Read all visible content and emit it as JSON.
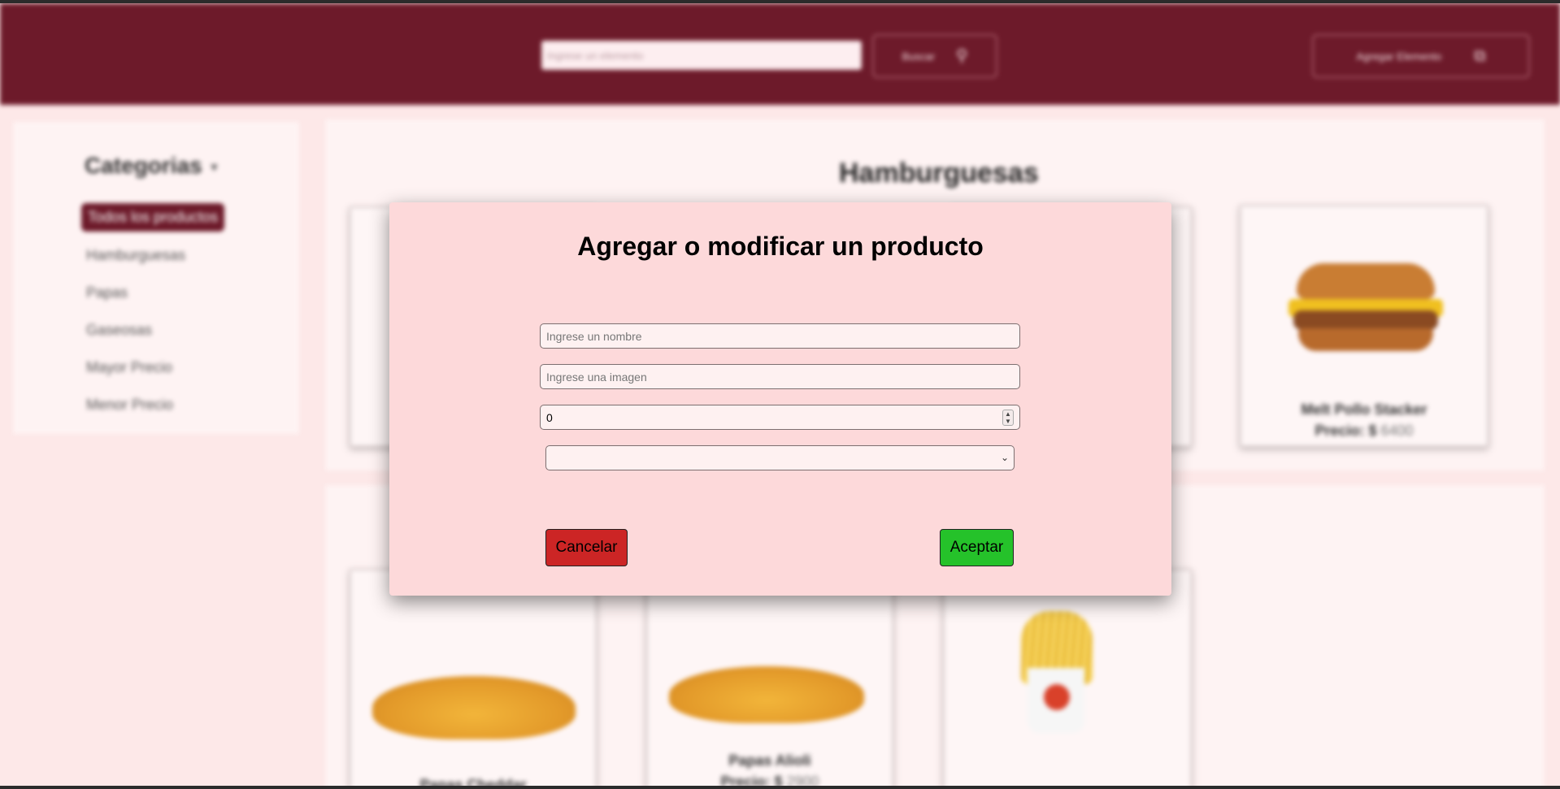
{
  "header": {
    "search_placeholder": "Ingrese un elemento",
    "search_button": "Buscar",
    "add_button": "Agregar Elemento"
  },
  "sidebar": {
    "title": "Categorias",
    "items": [
      {
        "label": "Todos los productos",
        "active": true
      },
      {
        "label": "Hamburguesas"
      },
      {
        "label": "Papas"
      },
      {
        "label": "Gaseosas"
      },
      {
        "label": "Mayor Precio"
      },
      {
        "label": "Menor Precio"
      }
    ]
  },
  "main": {
    "section_title": "Hamburguesas",
    "cards": [
      {
        "name": "Melt Pollo Stacker",
        "price_label": "Precio: $",
        "price": "6400"
      },
      {
        "name": "Papas Alioli",
        "price_label": "Precio: $",
        "price": "2900"
      }
    ],
    "partial_card_name": "Papas Cheddar"
  },
  "modal": {
    "title": "Agregar o modificar un producto",
    "name_placeholder": "Ingrese un nombre",
    "image_placeholder": "Ingrese una imagen",
    "number_value": "0",
    "select_value": "",
    "cancel_label": "Cancelar",
    "accept_label": "Aceptar"
  },
  "colors": {
    "header": "#6d1a2a",
    "modal_bg": "#fdd9da",
    "cancel": "#cc2525",
    "accept": "#25c22a"
  },
  "icons": {
    "search": "search-icon",
    "add": "copy-icon",
    "caret": "caret-down-icon",
    "select_chevron": "chevron-down-icon",
    "spinner": "spinner-arrows-icon"
  }
}
